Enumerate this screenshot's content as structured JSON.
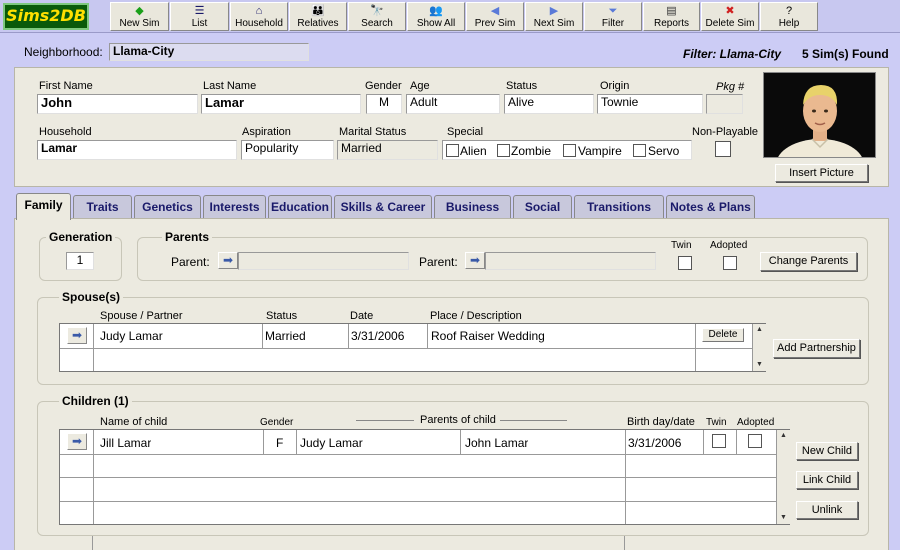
{
  "app": {
    "logo": "Sims2DB"
  },
  "toolbar": [
    {
      "label": "New Sim",
      "icon": "◆",
      "icon_name": "new-sim-icon",
      "color": "#1aa01a"
    },
    {
      "label": "List",
      "icon": "☰",
      "icon_name": "list-icon",
      "color": "#1a1a6a"
    },
    {
      "label": "Household",
      "icon": "⌂",
      "icon_name": "household-icon",
      "color": "#1a1a6a"
    },
    {
      "label": "Relatives",
      "icon": "👪",
      "icon_name": "relatives-icon",
      "color": "#1a1a6a"
    },
    {
      "label": "Search",
      "icon": "🔭",
      "icon_name": "binoculars-icon",
      "color": "#000"
    },
    {
      "label": "Show All",
      "icon": "👥",
      "icon_name": "show-all-icon",
      "color": "#1a1a6a"
    },
    {
      "label": "Prev Sim",
      "icon": "◀",
      "icon_name": "prev-arrow-icon",
      "color": "#5a7ad8"
    },
    {
      "label": "Next Sim",
      "icon": "▶",
      "icon_name": "next-arrow-icon",
      "color": "#5a7ad8"
    },
    {
      "label": "Filter",
      "icon": "⏷",
      "icon_name": "filter-icon",
      "color": "#5a7ad8"
    },
    {
      "label": "Reports",
      "icon": "▤",
      "icon_name": "reports-icon",
      "color": "#333"
    },
    {
      "label": "Delete Sim",
      "icon": "✖",
      "icon_name": "delete-icon",
      "color": "#d02020"
    },
    {
      "label": "Help",
      "icon": "?",
      "icon_name": "help-icon",
      "color": "#000"
    }
  ],
  "neighborhood": {
    "label": "Neighborhood:",
    "value": "Llama-City"
  },
  "filter": {
    "text": "Filter: Llama-City",
    "found": "5 Sim(s) Found"
  },
  "sim": {
    "first_name_label": "First Name",
    "first_name": "John",
    "last_name_label": "Last Name",
    "last_name": "Lamar",
    "gender_label": "Gender",
    "gender": "M",
    "age_label": "Age",
    "age": "Adult",
    "status_label": "Status",
    "status": "Alive",
    "origin_label": "Origin",
    "origin": "Townie",
    "pkg_label": "Pkg #",
    "pkg": "",
    "household_label": "Household",
    "household": "Lamar",
    "aspiration_label": "Aspiration",
    "aspiration": "Popularity",
    "marital_label": "Marital Status",
    "marital": "Married",
    "special_label": "Special",
    "special": [
      "Alien",
      "Zombie",
      "Vampire",
      "Servo"
    ],
    "nonplayable_label": "Non-Playable",
    "insert_picture": "Insert Picture"
  },
  "tabs": [
    "Family",
    "Traits",
    "Genetics",
    "Interests",
    "Education",
    "Skills & Career",
    "Business",
    "Social",
    "Transitions",
    "Notes & Plans"
  ],
  "family": {
    "generation_label": "Generation",
    "generation": "1",
    "parents_label": "Parents",
    "parent_label": "Parent:",
    "twin_label": "Twin",
    "adopted_label": "Adopted",
    "change_parents": "Change Parents",
    "spouses_label": "Spouse(s)",
    "spouse_columns": [
      "Spouse / Partner",
      "Status",
      "Date",
      "Place / Description"
    ],
    "spouses": [
      {
        "name": "Judy Lamar",
        "status": "Married",
        "date": "3/31/2006",
        "place": "Roof Raiser Wedding"
      }
    ],
    "delete_label": "Delete",
    "add_partnership": "Add Partnership",
    "children_label": "Children (1)",
    "child_columns": {
      "name": "Name of child",
      "gender": "Gender",
      "parents": "Parents of child",
      "birth": "Birth day/date",
      "twin": "Twin",
      "adopted": "Adopted"
    },
    "children": [
      {
        "name": "Jill Lamar",
        "gender": "F",
        "parent1": "Judy Lamar",
        "parent2": "John Lamar",
        "birth": "3/31/2006"
      }
    ],
    "new_child": "New Child",
    "link_child": "Link Child",
    "unlink": "Unlink"
  }
}
